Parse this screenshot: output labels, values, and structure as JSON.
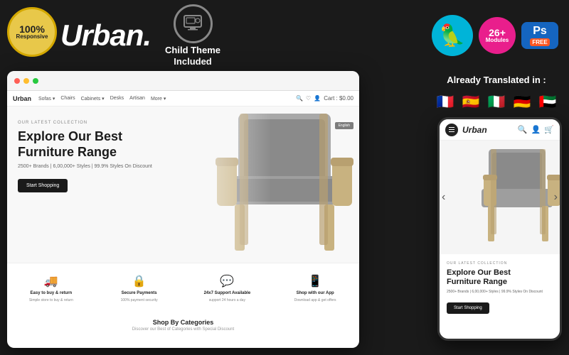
{
  "responsive_badge": {
    "percent": "100%",
    "text": "Responsive"
  },
  "brand": {
    "name": "Urban.",
    "tagline": "Urban"
  },
  "child_theme": {
    "title_line1": "Child Theme",
    "title_line2": "Included"
  },
  "modules": {
    "count": "26+",
    "label": "Modules"
  },
  "ps_badge": {
    "text": "Ps",
    "free": "FREE"
  },
  "translation": {
    "title": "Already Translated in :"
  },
  "flags": [
    "🇫🇷",
    "🇪🇸",
    "🇮🇹",
    "🇩🇪",
    "🇦🇪"
  ],
  "browser": {
    "nav_brand": "Urban",
    "nav_links": [
      "Sofas ▾",
      "Chairs",
      "Cabinets ▾",
      "Desks",
      "Artisan",
      "More ▾"
    ],
    "cart": "Cart : $0.00",
    "lang": "English"
  },
  "hero": {
    "label": "OUR LATEST COLLECTION",
    "title_line1": "Explore Our Best",
    "title_line2": "Furniture Range",
    "subtitle": "2500+ Brands | 6,00,000+ Styles | 99.9% Styles On Discount",
    "button": "Start Shopping"
  },
  "features": [
    {
      "icon": "🚚",
      "title": "Easy to buy & return",
      "desc": "Simple store to buy & return"
    },
    {
      "icon": "🔒",
      "title": "Secure Payments",
      "desc": "100% payment security"
    },
    {
      "icon": "💬",
      "title": "24x7 Support Available",
      "desc": "support 24 hours a day"
    },
    {
      "icon": "📱",
      "title": "Shop with our App",
      "desc": "Download app & get offers"
    }
  ],
  "categories": {
    "title": "Shop By Categories",
    "subtitle": "Discover our Best of Categories with Special Discount"
  },
  "mobile": {
    "brand": "Urban",
    "label": "OUR LATEST COLLECTION",
    "title_line1": "Explore Our Best",
    "title_line2": "Furniture Range",
    "subtitle": "2500+ Brands | 6,00,000+ Styles | 99.9% Styles On Discount",
    "button": "Start Shopping"
  }
}
